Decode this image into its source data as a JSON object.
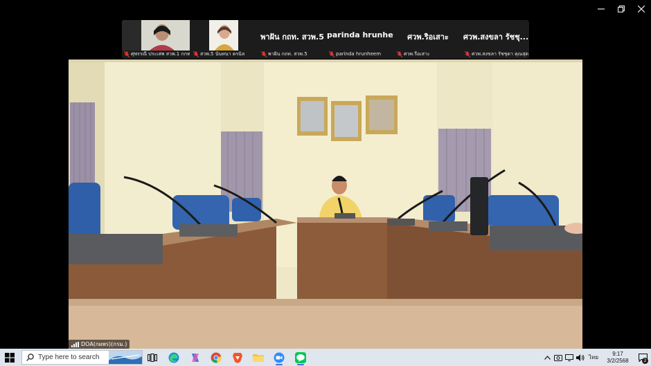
{
  "participants": [
    {
      "name": "ศุพรรณี ประเสพ สวพ.1 กกท."
    },
    {
      "name": "สวพ.5 นันทนา ดรนิล"
    },
    {
      "display_name": "พาฝัน กถท. สวพ.5",
      "name": "พาฝัน กถท. สวพ.5"
    },
    {
      "display_name": "parinda hrunhe...",
      "name": "parinda hrunheem"
    },
    {
      "display_name": "ศวพ.ริอเสาะ",
      "name": "ศวพ.รือเสาะ"
    },
    {
      "display_name": "ศวพ.สงขลา รัชชุ...",
      "name": "ศวพ.สงขลา รัชชุดา คุณสุด"
    }
  ],
  "main_video": {
    "connection_label": "DOA(กผพร)(กรม.)"
  },
  "taskbar": {
    "search_placeholder": "Type here to search",
    "language": "ไทย",
    "time": "9:17",
    "date": "3/2/2568",
    "notification_count": "2"
  },
  "colors": {
    "strip_bg": "#1c1c1c",
    "taskbar_bg": "#dfe6ee",
    "muted_mic": "#e23b3b"
  }
}
